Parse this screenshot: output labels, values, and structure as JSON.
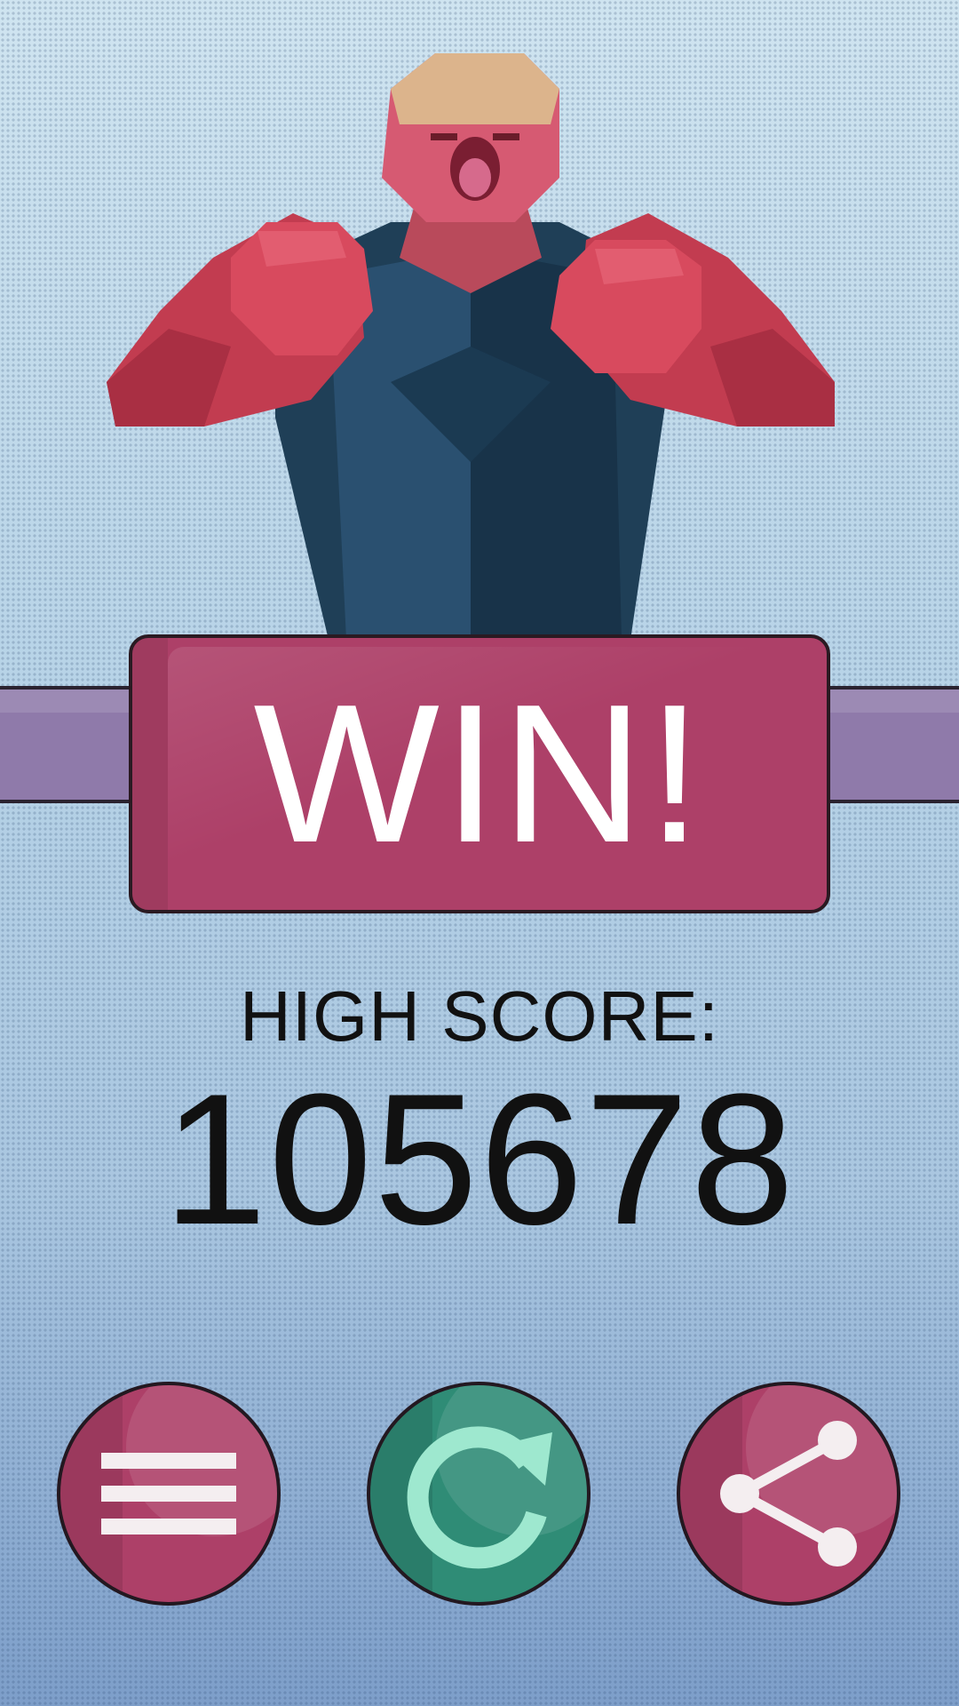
{
  "result": {
    "title": "WIN!"
  },
  "score": {
    "label": "HIGH SCORE:",
    "value": "105678"
  },
  "buttons": [
    {
      "name": "menu",
      "icon": "hamburger-menu-icon"
    },
    {
      "name": "restart",
      "icon": "restart-icon"
    },
    {
      "name": "share",
      "icon": "share-icon"
    }
  ],
  "colors": {
    "banner": "#ad4068",
    "band": "#8f7aaa",
    "restart_button": "#2f8c76",
    "restart_icon": "#9ee8cf",
    "text": "#111111"
  }
}
